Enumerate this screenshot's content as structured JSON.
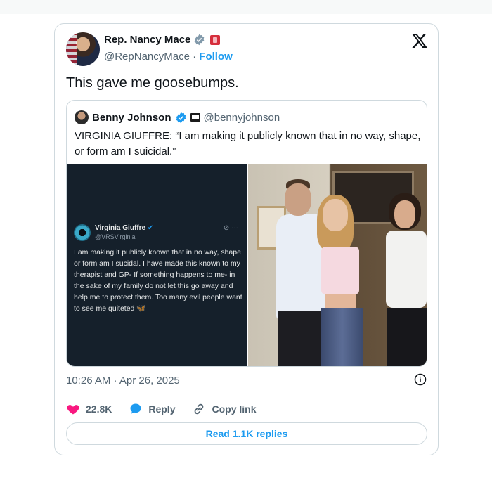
{
  "tweet": {
    "author_name": "Rep. Nancy Mace",
    "author_handle": "@RepNancyMace",
    "follow_label": "Follow",
    "separator": "·",
    "text": "This gave me goosebumps.",
    "timestamp": "10:26 AM · Apr 26, 2025",
    "likes": "22.8K",
    "reply_label": "Reply",
    "copy_link_label": "Copy link",
    "read_replies_label": "Read 1.1K replies"
  },
  "quote": {
    "author_name": "Benny Johnson",
    "author_handle": "@bennyjohnson",
    "text": "VIRGINIA GIUFFRE: “I am making it publicly known that in no way, shape, or form am I suicidal.”"
  },
  "embedded_post": {
    "author_name": "Virginia Giuffre",
    "author_handle": "@VRSVirginia",
    "text": "I am making it publicly known that in no way, shape or form am I sucidal. I have made this known to my therapist and GP- If something happens to me- in the sake of my family do not let this go away and help me to protect them. Too many evil people want to see me quiteted 🦋"
  },
  "colors": {
    "accent": "#1d9bf0",
    "like": "#f91880",
    "muted": "#536471",
    "dark_card": "#15202b"
  },
  "icons": {
    "verified": "verified-badge-icon",
    "close": "x-logo-icon",
    "like": "heart-icon",
    "reply": "speech-bubble-icon",
    "copy": "link-icon",
    "info": "info-icon"
  }
}
